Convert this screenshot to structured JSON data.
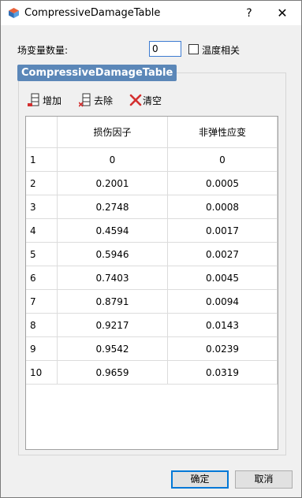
{
  "window": {
    "title": "CompressiveDamageTable",
    "help_label": "?",
    "close_label": "✕"
  },
  "form": {
    "count_label": "场变量数量:",
    "count_value": "0",
    "temp_label": "温度相关",
    "temp_checked": false
  },
  "group": {
    "title": "CompressiveDamageTable"
  },
  "toolbar": {
    "add_label": "增加",
    "remove_label": "去除",
    "clear_label": "清空"
  },
  "table": {
    "headers": [
      "损伤因子",
      "非弹性应变"
    ],
    "rows": [
      {
        "index": "1",
        "damage": "0",
        "strain": "0"
      },
      {
        "index": "2",
        "damage": "0.2001",
        "strain": "0.0005"
      },
      {
        "index": "3",
        "damage": "0.2748",
        "strain": "0.0008"
      },
      {
        "index": "4",
        "damage": "0.4594",
        "strain": "0.0017"
      },
      {
        "index": "5",
        "damage": "0.5946",
        "strain": "0.0027"
      },
      {
        "index": "6",
        "damage": "0.7403",
        "strain": "0.0045"
      },
      {
        "index": "7",
        "damage": "0.8791",
        "strain": "0.0094"
      },
      {
        "index": "8",
        "damage": "0.9217",
        "strain": "0.0143"
      },
      {
        "index": "9",
        "damage": "0.9542",
        "strain": "0.0239"
      },
      {
        "index": "10",
        "damage": "0.9659",
        "strain": "0.0319"
      }
    ]
  },
  "buttons": {
    "ok_label": "确定",
    "cancel_label": "取消"
  },
  "colors": {
    "group_title_bg": "#5b87b8",
    "accent": "#0078d7",
    "delete_red": "#d32f2f"
  }
}
